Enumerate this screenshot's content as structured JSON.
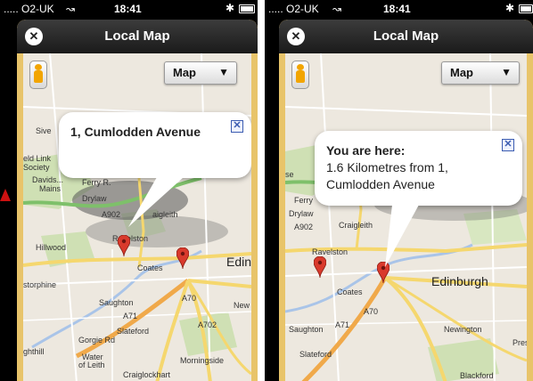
{
  "status_left": {
    "carrier": "..... O2-UK",
    "wifi": "↝",
    "time": "18:41",
    "bluetooth": "✱"
  },
  "status_right": {
    "carrier": "..... O2-UK",
    "wifi": "↝",
    "time": "18:41",
    "bluetooth": "✱"
  },
  "left_screen": {
    "title": "Local Map",
    "close_glyph": "✕",
    "map_type_select": {
      "value": "Map",
      "arrow": "▼"
    },
    "info_bubble": {
      "line1": "1, Cumlodden Avenue",
      "close_glyph": "✕"
    },
    "labels": {
      "davids": "Davids...",
      "mains": "Mains",
      "ferry": "Ferry R.",
      "drylaw": "Drylaw",
      "a902": "A902",
      "craigleith": "aigleith",
      "ravelston": "Ravelston",
      "hillwood": "Hillwood",
      "coates": "Coates",
      "edin": "Edin",
      "storphine": "storphine",
      "saughton": "Saughton",
      "a71": "A71",
      "a70": "A70",
      "slateford": "Slateford",
      "gorgie": "Gorgie Rd",
      "water": "Water",
      "of_leith": "of Leith",
      "ghthill": "ghthill",
      "morningside": "Morningside",
      "craiglockhart": "Craiglockhart",
      "new": "New",
      "a702": "A702",
      "field": "eld Link",
      "society": "Society",
      "sive": "Sive"
    }
  },
  "right_screen": {
    "title": "Local Map",
    "close_glyph": "✕",
    "map_type_select": {
      "value": "Map",
      "arrow": "▼"
    },
    "info_bubble": {
      "line1": "You are here:",
      "line2": "1.6 Kilometres from 1,",
      "line3": "Cumlodden Avenue",
      "close_glyph": "✕"
    },
    "labels": {
      "se": "se",
      "ferry": "Ferry",
      "drylaw": "Drylaw",
      "a902": "A902",
      "craigleith": "Craigleith",
      "ravelston": "Ravelston",
      "coates": "Coates",
      "edinburgh": "Edinburgh",
      "saughton": "Saughton",
      "a71": "A71",
      "a70": "A70",
      "slateford": "Slateford",
      "newington": "Newington",
      "pres": "Pres",
      "blackford": "Blackford"
    }
  },
  "colors": {
    "map_bg": "#ede8df",
    "road_yellow": "#f5d76e",
    "road_orange": "#f0a94a",
    "park_green": "#cfe0b4",
    "water": "#a9c4e8",
    "pin_red": "#d93a2c"
  }
}
